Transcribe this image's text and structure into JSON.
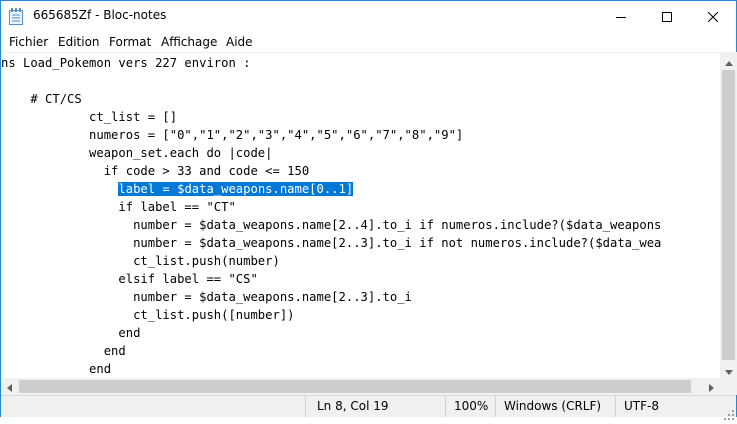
{
  "window": {
    "title": "665685Zf - Bloc-notes",
    "accent_color": "#1e8ad6"
  },
  "controls": {
    "minimize_icon": "minimize-icon",
    "maximize_icon": "maximize-icon",
    "close_icon": "close-icon"
  },
  "menu": {
    "items": [
      "Fichier",
      "Edition",
      "Format",
      "Affichage",
      "Aide"
    ]
  },
  "editor": {
    "lines": [
      "ns Load_Pokemon vers 227 environ :",
      "",
      "    # CT/CS",
      "            ct_list = []",
      "            numeros = [\"0\",\"1\",\"2\",\"3\",\"4\",\"5\",\"6\",\"7\",\"8\",\"9\"]",
      "            weapon_set.each do |code|",
      "              if code > 33 and code <= 150",
      "                label = $data_weapons.name[0..1]",
      "                if label == \"CT\"",
      "                  number = $data_weapons.name[2..4].to_i if numeros.include?($data_weapons",
      "                  number = $data_weapons.name[2..3].to_i if not numeros.include?($data_wea",
      "                  ct_list.push(number)",
      "                elsif label == \"CS\"",
      "                  number = $data_weapons.name[2..3].to_i",
      "                  ct_list.push([number])",
      "                end",
      "              end",
      "            end"
    ],
    "selected_line_index": 7,
    "selected_text": "label = $data_weapons.name[0..1]",
    "selection_color": "#0078d7"
  },
  "statusbar": {
    "position": "Ln 8, Col 19",
    "zoom": "100%",
    "line_ending": "Windows (CRLF)",
    "encoding": "UTF-8"
  }
}
